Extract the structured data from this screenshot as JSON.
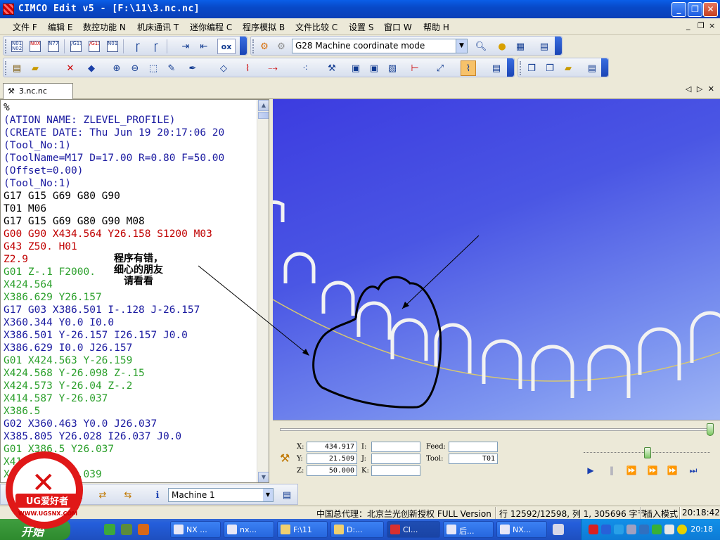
{
  "window": {
    "title": "CIMCO Edit v5 - [F:\\11\\3.nc.nc]",
    "minimize": "_",
    "restore": "❐",
    "close": "✕"
  },
  "menu": {
    "items": [
      "文件 F",
      "编辑 E",
      "数控功能 N",
      "机床通讯 T",
      "迷你编程 C",
      "程序模拟 B",
      "文件比较 C",
      "设置 S",
      "窗口 W",
      "帮助 H"
    ],
    "mdi_min": "_",
    "mdi_restore": "❐",
    "mdi_close": "×"
  },
  "toolbar": {
    "mode_select": "G28 Machine coordinate mode",
    "ox_label": "ox"
  },
  "tab": {
    "label": "3.nc.nc",
    "nav": "◁ ▷ ✕"
  },
  "editor": {
    "lines": [
      {
        "text": "%",
        "color": "#000000"
      },
      {
        "text": "(ATION NAME: ZLEVEL_PROFILE)",
        "color": "#1a1aa0"
      },
      {
        "text": "(CREATE DATE: Thu Jun 19 20:17:06 20",
        "color": "#1a1aa0"
      },
      {
        "text": "(Tool_No:1)",
        "color": "#1a1aa0"
      },
      {
        "text": "(ToolName=M17 D=17.00 R=0.80 F=50.00",
        "color": "#1a1aa0"
      },
      {
        "text": "(Offset=0.00)",
        "color": "#1a1aa0"
      },
      {
        "text": "(Tool_No:1)",
        "color": "#1a1aa0"
      },
      {
        "text": "G17 G15 G69 G80 G90",
        "color": "#000000"
      },
      {
        "text": "T01 M06",
        "color": "#000000"
      },
      {
        "text": "G17 G15 G69 G80 G90 M08",
        "color": "#000000"
      },
      {
        "text": "G00 G90 X434.564 Y26.158 S1200 M03",
        "color": "#c00000"
      },
      {
        "text": "G43 Z50. H01",
        "color": "#c00000"
      },
      {
        "text": "Z2.9",
        "color": "#c00000"
      },
      {
        "text": "G01 Z-.1 F2000.",
        "color": "#2ca02c"
      },
      {
        "text": "X424.564",
        "color": "#2ca02c"
      },
      {
        "text": "X386.629 Y26.157",
        "color": "#2ca02c"
      },
      {
        "text": "G17 G03 X386.501 I-.128 J-26.157",
        "color": "#1a1aa0"
      },
      {
        "text": "X360.344 Y0.0 I0.0",
        "color": "#1a1aa0"
      },
      {
        "text": "X386.501 Y-26.157 I26.157 J0.0",
        "color": "#1a1aa0"
      },
      {
        "text": "X386.629 I0.0 J26.157",
        "color": "#1a1aa0"
      },
      {
        "text": "G01 X424.563 Y-26.159",
        "color": "#2ca02c"
      },
      {
        "text": "X424.568 Y-26.098 Z-.15",
        "color": "#2ca02c"
      },
      {
        "text": "X424.573 Y-26.04 Z-.2",
        "color": "#2ca02c"
      },
      {
        "text": "X414.587 Y-26.037",
        "color": "#2ca02c"
      },
      {
        "text": "X386.5",
        "color": "#2ca02c"
      },
      {
        "text": "G02 X360.463 Y0.0 J26.037",
        "color": "#1a1aa0"
      },
      {
        "text": "X385.805 Y26.028 I26.037 J0.0",
        "color": "#1a1aa0"
      },
      {
        "text": "G01 X386.5 Y26.037",
        "color": "#2ca02c"
      },
      {
        "text": "X414.588",
        "color": "#2ca02c"
      },
      {
        "text": "X424.578 Y26.039",
        "color": "#2ca02c"
      }
    ]
  },
  "annotation": {
    "line1": "程序有错，",
    "line2": "细心的朋友",
    "line3": "请看看"
  },
  "sim": {
    "x_label": "X:",
    "x": "434.917",
    "y_label": "Y:",
    "y": "21.509",
    "z_label": "Z:",
    "z": "50.000",
    "i_label": "I:",
    "i": "",
    "j_label": "J:",
    "j": "",
    "k_label": "K:",
    "k": "",
    "feed_label": "Feed:",
    "feed": "",
    "tool_label": "Tool:",
    "tool": "T01",
    "progress_fraction": 0.99,
    "speed_fraction": 0.5
  },
  "bottom_toolbar": {
    "machine": "Machine 1"
  },
  "status": {
    "license": "中国总代理：北京兰光创新授权 FULL Version",
    "position": "行 12592/12598, 列 1, 305696 字节",
    "mode": "插入模式",
    "time": "20:18:42"
  },
  "taskbar": {
    "start": "开始",
    "tasks": [
      "NX ...",
      "nx...",
      "F:\\11",
      "D:...",
      "CI...",
      "后...",
      "NX..."
    ],
    "clock": "20:18"
  },
  "watermark": {
    "title": "UG爱好者",
    "url": "WWW.UGSNX.COM"
  }
}
